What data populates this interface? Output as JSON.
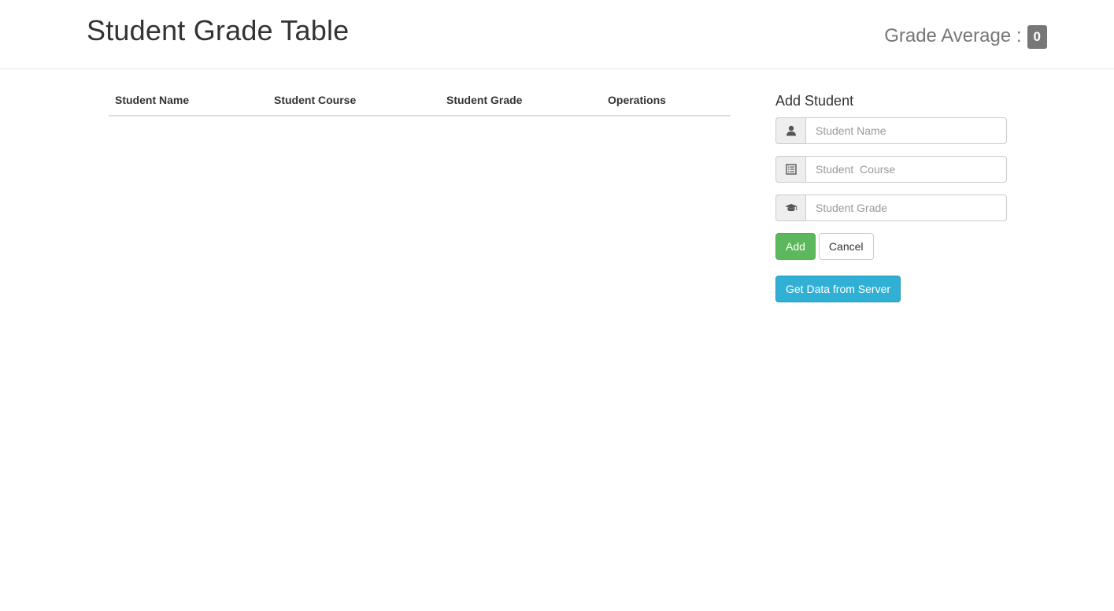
{
  "header": {
    "title": "Student Grade Table",
    "average_label": "Grade Average :",
    "average_value": "0"
  },
  "table": {
    "columns": [
      "Student Name",
      "Student Course",
      "Student Grade",
      "Operations"
    ],
    "rows": []
  },
  "form": {
    "title": "Add Student",
    "name_placeholder": "Student Name",
    "course_placeholder": "Student  Course",
    "grade_placeholder": "Student Grade",
    "name_icon": "user-icon",
    "course_icon": "list-alt-icon",
    "grade_icon": "education-icon",
    "add_label": "Add",
    "cancel_label": "Cancel",
    "server_label": "Get Data from Server"
  },
  "colors": {
    "success": "#5cb85c",
    "info": "#31b0d5",
    "badge": "#777777"
  }
}
